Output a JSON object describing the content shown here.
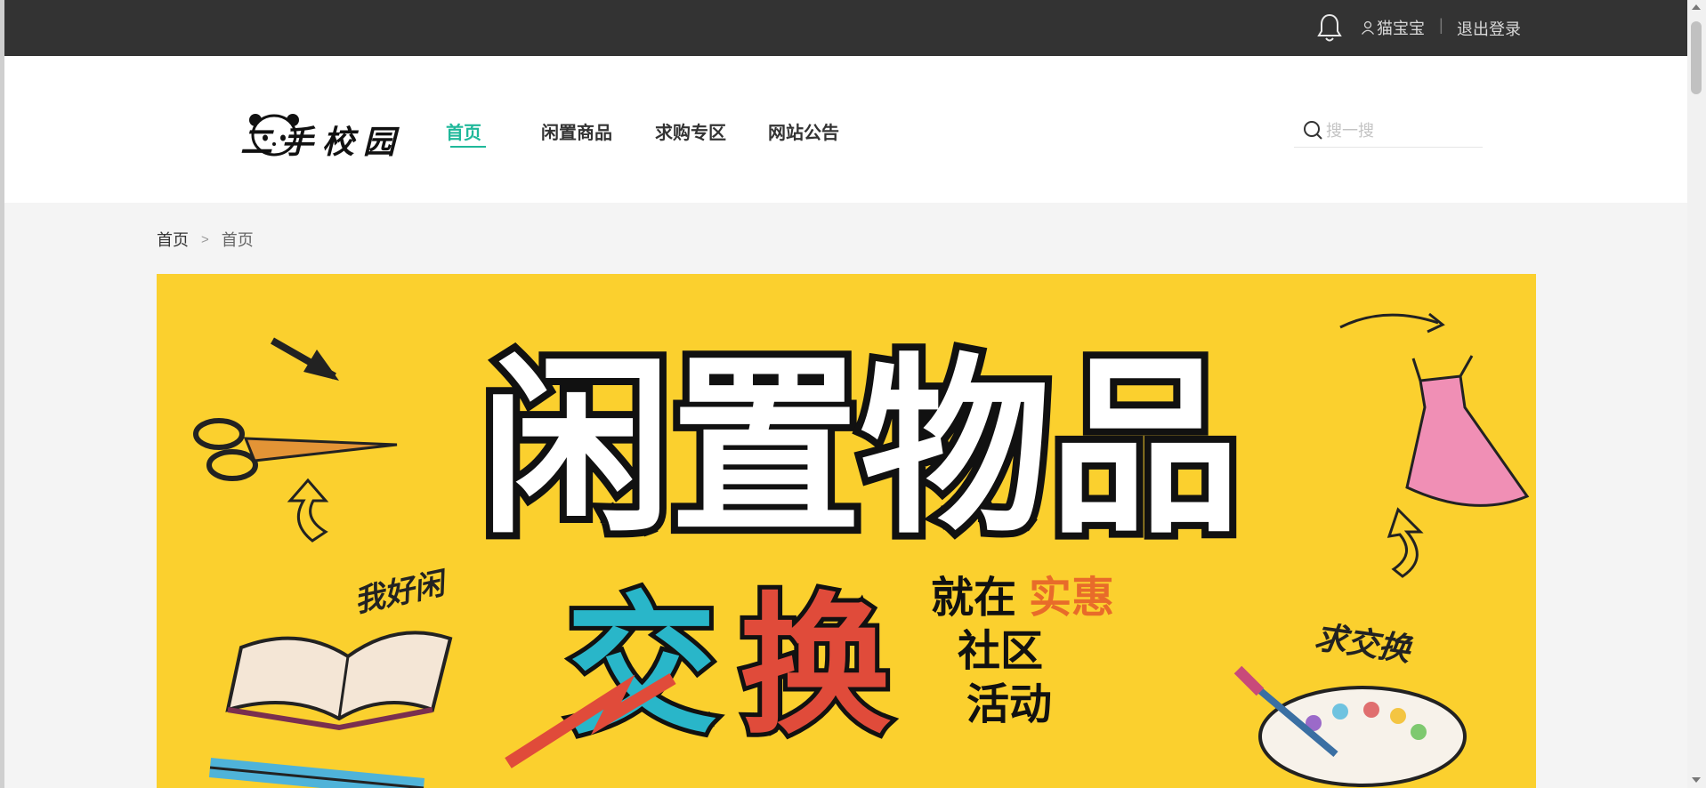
{
  "topbar": {
    "username": "猫宝宝",
    "separator": "|",
    "logout": "退出登录"
  },
  "header": {
    "logo_text": "二手校园",
    "nav": [
      {
        "label": "首页",
        "active": true
      },
      {
        "label": "闲置商品",
        "active": false
      },
      {
        "label": "求购专区",
        "active": false
      },
      {
        "label": "网站公告",
        "active": false
      }
    ],
    "search": {
      "placeholder": "搜一搜",
      "value": ""
    }
  },
  "breadcrumb": {
    "home": "首页",
    "separator": ">",
    "current": "首页"
  },
  "banner": {
    "title": "闲置物品",
    "big_text_1": "交",
    "big_text_2": "换",
    "line1_a": "就在",
    "line1_b": "实惠",
    "line2": "社区",
    "line3": "活动",
    "handwriting_left": "我好闲",
    "handwriting_right": "求交换",
    "colors": {
      "background": "#fbd02e",
      "cyan": "#29b6c9",
      "red": "#e04b3a",
      "orange": "#e86b2a"
    }
  },
  "theme": {
    "accent": "#1fb89a",
    "topbar": "#333333"
  }
}
